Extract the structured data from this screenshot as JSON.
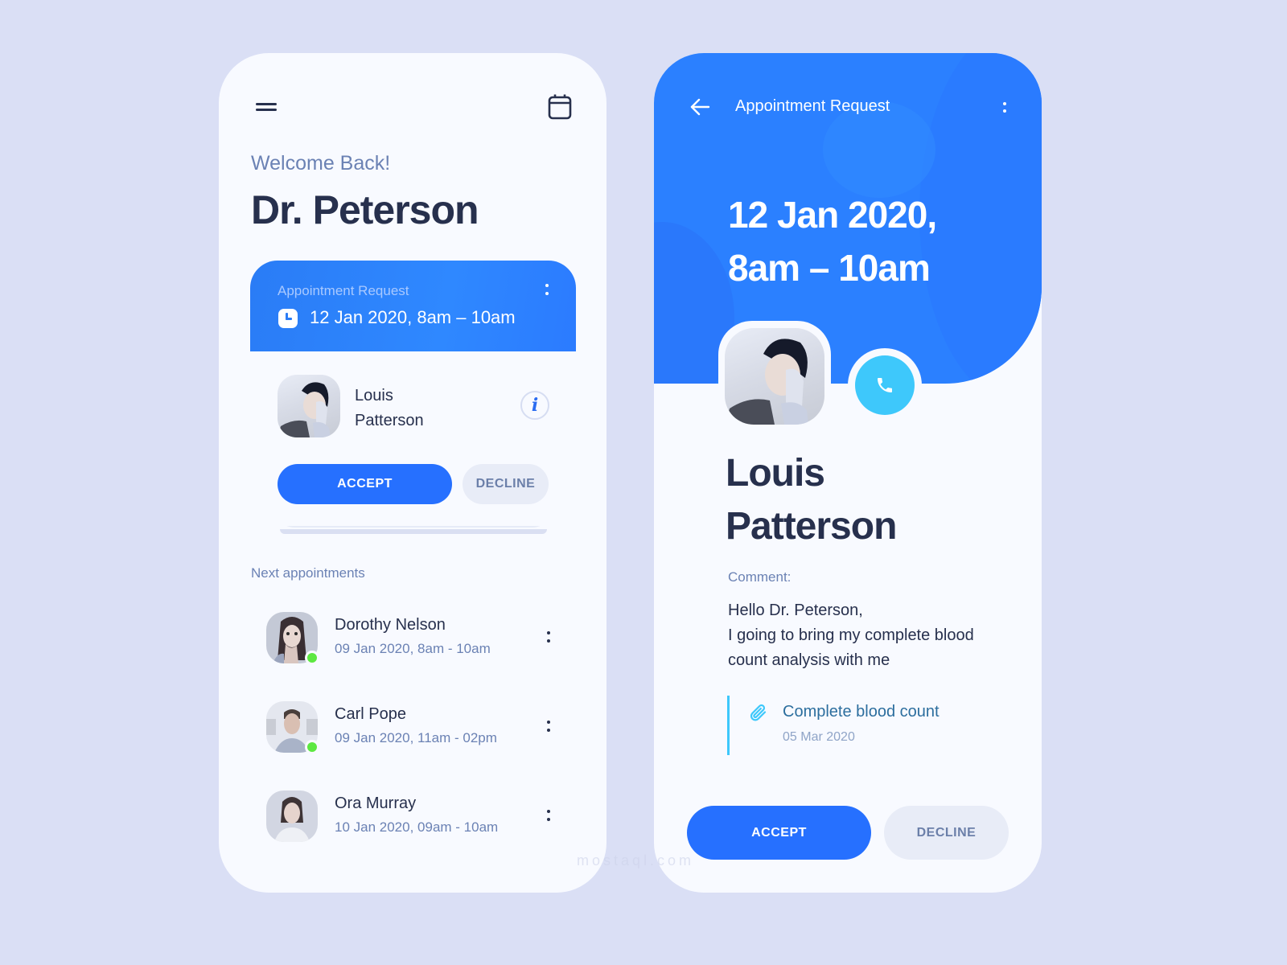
{
  "left": {
    "header": {
      "menu_icon": "menu-icon",
      "calendar_icon": "calendar-icon"
    },
    "greeting": "Welcome Back!",
    "doctor_name": "Dr. Peterson",
    "request_card": {
      "label": "Appointment Request",
      "time": "12 Jan 2020, 8am – 10am",
      "patient_first": "Louis",
      "patient_last": "Patterson",
      "info_icon": "i",
      "accept_label": "ACCEPT",
      "decline_label": "DECLINE"
    },
    "next_title": "Next appointments",
    "appointments": [
      {
        "name": "Dorothy Nelson",
        "time": "09 Jan 2020, 8am - 10am",
        "online": true
      },
      {
        "name": "Carl Pope",
        "time": "09 Jan 2020, 11am - 02pm",
        "online": true
      },
      {
        "name": "Ora Murray",
        "time": "10 Jan 2020, 09am - 10am",
        "online": false
      }
    ]
  },
  "right": {
    "title": "Appointment Request",
    "date_line1": "12 Jan 2020,",
    "date_line2": "8am – 10am",
    "patient_first": "Louis",
    "patient_last": "Patterson",
    "comment_label": "Comment:",
    "comment_lines": [
      "Hello Dr. Peterson,",
      "I going to bring my complete blood",
      "count analysis with me"
    ],
    "attachment": {
      "title": "Complete blood count",
      "date": "05 Mar 2020"
    },
    "accept_label": "ACCEPT",
    "decline_label": "DECLINE"
  },
  "colors": {
    "primary": "#2670ff",
    "hero": "#2b80ff",
    "call": "#3ec8fb",
    "online": "#5de841",
    "text_dark": "#27304d",
    "text_muted": "#6b82b4",
    "background": "#dadff5"
  },
  "watermark": "mostaql.com"
}
